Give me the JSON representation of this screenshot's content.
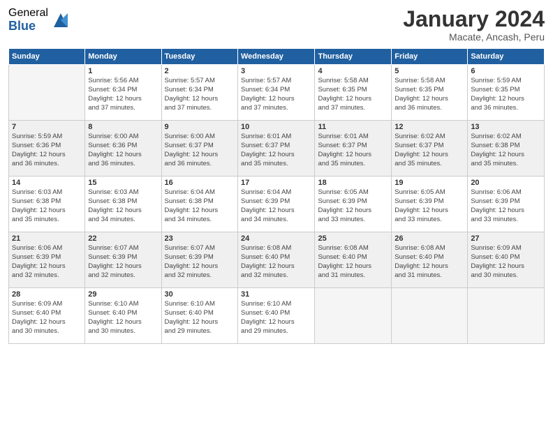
{
  "header": {
    "logo_general": "General",
    "logo_blue": "Blue",
    "month_year": "January 2024",
    "location": "Macate, Ancash, Peru"
  },
  "days_of_week": [
    "Sunday",
    "Monday",
    "Tuesday",
    "Wednesday",
    "Thursday",
    "Friday",
    "Saturday"
  ],
  "weeks": [
    [
      {
        "day": "",
        "empty": true
      },
      {
        "day": "1",
        "sunrise": "5:56 AM",
        "sunset": "6:34 PM",
        "daylight": "12 hours and 37 minutes."
      },
      {
        "day": "2",
        "sunrise": "5:57 AM",
        "sunset": "6:34 PM",
        "daylight": "12 hours and 37 minutes."
      },
      {
        "day": "3",
        "sunrise": "5:57 AM",
        "sunset": "6:34 PM",
        "daylight": "12 hours and 37 minutes."
      },
      {
        "day": "4",
        "sunrise": "5:58 AM",
        "sunset": "6:35 PM",
        "daylight": "12 hours and 37 minutes."
      },
      {
        "day": "5",
        "sunrise": "5:58 AM",
        "sunset": "6:35 PM",
        "daylight": "12 hours and 36 minutes."
      },
      {
        "day": "6",
        "sunrise": "5:59 AM",
        "sunset": "6:35 PM",
        "daylight": "12 hours and 36 minutes."
      }
    ],
    [
      {
        "day": "7",
        "sunrise": "5:59 AM",
        "sunset": "6:36 PM",
        "daylight": "12 hours and 36 minutes."
      },
      {
        "day": "8",
        "sunrise": "6:00 AM",
        "sunset": "6:36 PM",
        "daylight": "12 hours and 36 minutes."
      },
      {
        "day": "9",
        "sunrise": "6:00 AM",
        "sunset": "6:37 PM",
        "daylight": "12 hours and 36 minutes."
      },
      {
        "day": "10",
        "sunrise": "6:01 AM",
        "sunset": "6:37 PM",
        "daylight": "12 hours and 35 minutes."
      },
      {
        "day": "11",
        "sunrise": "6:01 AM",
        "sunset": "6:37 PM",
        "daylight": "12 hours and 35 minutes."
      },
      {
        "day": "12",
        "sunrise": "6:02 AM",
        "sunset": "6:37 PM",
        "daylight": "12 hours and 35 minutes."
      },
      {
        "day": "13",
        "sunrise": "6:02 AM",
        "sunset": "6:38 PM",
        "daylight": "12 hours and 35 minutes."
      }
    ],
    [
      {
        "day": "14",
        "sunrise": "6:03 AM",
        "sunset": "6:38 PM",
        "daylight": "12 hours and 35 minutes."
      },
      {
        "day": "15",
        "sunrise": "6:03 AM",
        "sunset": "6:38 PM",
        "daylight": "12 hours and 34 minutes."
      },
      {
        "day": "16",
        "sunrise": "6:04 AM",
        "sunset": "6:38 PM",
        "daylight": "12 hours and 34 minutes."
      },
      {
        "day": "17",
        "sunrise": "6:04 AM",
        "sunset": "6:39 PM",
        "daylight": "12 hours and 34 minutes."
      },
      {
        "day": "18",
        "sunrise": "6:05 AM",
        "sunset": "6:39 PM",
        "daylight": "12 hours and 33 minutes."
      },
      {
        "day": "19",
        "sunrise": "6:05 AM",
        "sunset": "6:39 PM",
        "daylight": "12 hours and 33 minutes."
      },
      {
        "day": "20",
        "sunrise": "6:06 AM",
        "sunset": "6:39 PM",
        "daylight": "12 hours and 33 minutes."
      }
    ],
    [
      {
        "day": "21",
        "sunrise": "6:06 AM",
        "sunset": "6:39 PM",
        "daylight": "12 hours and 32 minutes."
      },
      {
        "day": "22",
        "sunrise": "6:07 AM",
        "sunset": "6:39 PM",
        "daylight": "12 hours and 32 minutes."
      },
      {
        "day": "23",
        "sunrise": "6:07 AM",
        "sunset": "6:39 PM",
        "daylight": "12 hours and 32 minutes."
      },
      {
        "day": "24",
        "sunrise": "6:08 AM",
        "sunset": "6:40 PM",
        "daylight": "12 hours and 32 minutes."
      },
      {
        "day": "25",
        "sunrise": "6:08 AM",
        "sunset": "6:40 PM",
        "daylight": "12 hours and 31 minutes."
      },
      {
        "day": "26",
        "sunrise": "6:08 AM",
        "sunset": "6:40 PM",
        "daylight": "12 hours and 31 minutes."
      },
      {
        "day": "27",
        "sunrise": "6:09 AM",
        "sunset": "6:40 PM",
        "daylight": "12 hours and 30 minutes."
      }
    ],
    [
      {
        "day": "28",
        "sunrise": "6:09 AM",
        "sunset": "6:40 PM",
        "daylight": "12 hours and 30 minutes."
      },
      {
        "day": "29",
        "sunrise": "6:10 AM",
        "sunset": "6:40 PM",
        "daylight": "12 hours and 30 minutes."
      },
      {
        "day": "30",
        "sunrise": "6:10 AM",
        "sunset": "6:40 PM",
        "daylight": "12 hours and 29 minutes."
      },
      {
        "day": "31",
        "sunrise": "6:10 AM",
        "sunset": "6:40 PM",
        "daylight": "12 hours and 29 minutes."
      },
      {
        "day": "",
        "empty": true
      },
      {
        "day": "",
        "empty": true
      },
      {
        "day": "",
        "empty": true
      }
    ]
  ]
}
